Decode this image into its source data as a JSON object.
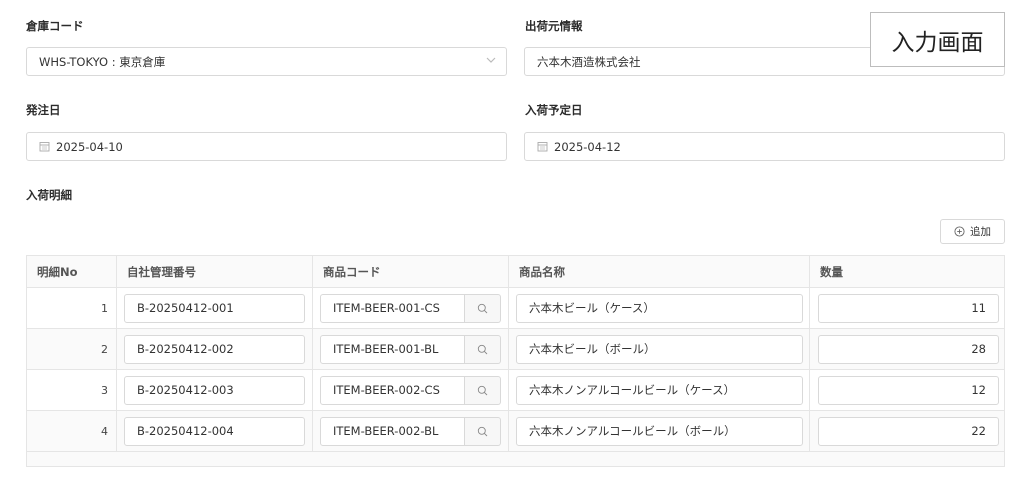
{
  "form": {
    "warehouse_label": "倉庫コード",
    "warehouse_value": "WHS-TOKYO : 東京倉庫",
    "shipper_label": "出荷元情報",
    "shipper_value": "六本木酒造株式会社",
    "order_date_label": "発注日",
    "order_date_value": "2025-04-10",
    "arrival_date_label": "入荷予定日",
    "arrival_date_value": "2025-04-12",
    "details_label": "入荷明細",
    "add_label": "追加"
  },
  "badge": "入力画面",
  "table": {
    "columns": [
      "明細No",
      "自社管理番号",
      "商品コード",
      "商品名称",
      "数量"
    ],
    "rows": [
      {
        "no": "1",
        "mgmt": "B-20250412-001",
        "code": "ITEM-BEER-001-CS",
        "name": "六本木ビール（ケース）",
        "qty": "11"
      },
      {
        "no": "2",
        "mgmt": "B-20250412-002",
        "code": "ITEM-BEER-001-BL",
        "name": "六本木ビール（ボール）",
        "qty": "28"
      },
      {
        "no": "3",
        "mgmt": "B-20250412-003",
        "code": "ITEM-BEER-002-CS",
        "name": "六本木ノンアルコールビール（ケース）",
        "qty": "12"
      },
      {
        "no": "4",
        "mgmt": "B-20250412-004",
        "code": "ITEM-BEER-002-BL",
        "name": "六本木ノンアルコールビール（ボール）",
        "qty": "22"
      }
    ]
  },
  "icons": {
    "select": "chevron-down-icon",
    "date": "calendar-icon",
    "search": "search-icon",
    "add": "plus-circle-icon"
  }
}
